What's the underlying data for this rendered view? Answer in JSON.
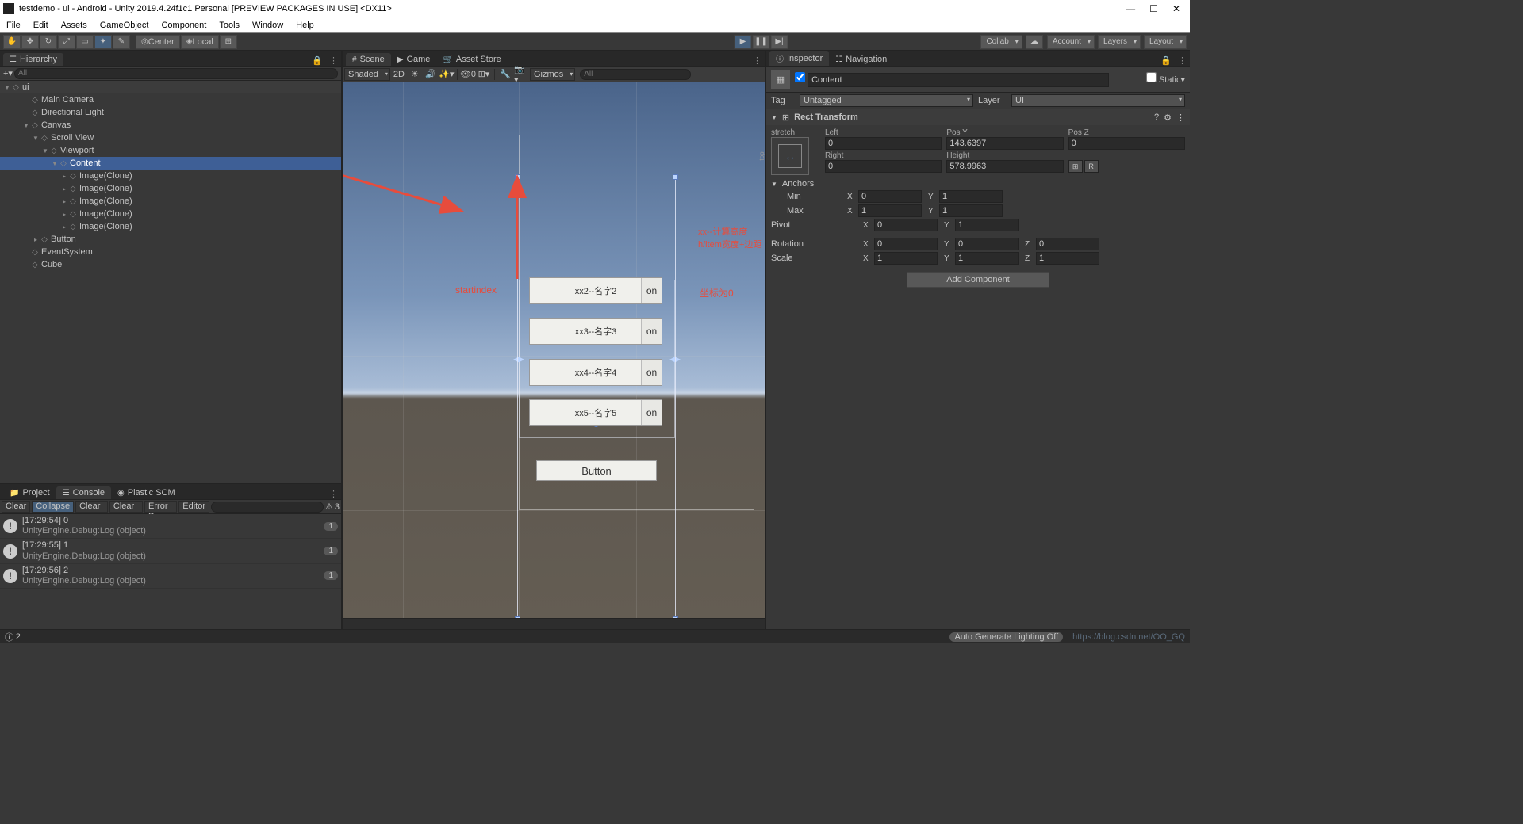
{
  "window": {
    "title": "testdemo - ui - Android - Unity 2019.4.24f1c1 Personal [PREVIEW PACKAGES IN USE] <DX11>"
  },
  "menu": [
    "File",
    "Edit",
    "Assets",
    "GameObject",
    "Component",
    "Tools",
    "Window",
    "Help"
  ],
  "toolbar": {
    "pivot_mode": "Center",
    "handle_mode": "Local",
    "collab": "Collab",
    "account": "Account",
    "layers": "Layers",
    "layout": "Layout"
  },
  "hierarchy": {
    "title": "Hierarchy",
    "search_placeholder": "All",
    "scene": "ui",
    "items": [
      {
        "name": "Main Camera",
        "indent": 2
      },
      {
        "name": "Directional Light",
        "indent": 2
      },
      {
        "name": "Canvas",
        "indent": 2,
        "expanded": true
      },
      {
        "name": "Scroll View",
        "indent": 3,
        "expanded": true
      },
      {
        "name": "Viewport",
        "indent": 4,
        "expanded": true
      },
      {
        "name": "Content",
        "indent": 5,
        "expanded": true,
        "selected": true
      },
      {
        "name": "Image(Clone)",
        "indent": 6,
        "arrow": true
      },
      {
        "name": "Image(Clone)",
        "indent": 6,
        "arrow": true
      },
      {
        "name": "Image(Clone)",
        "indent": 6,
        "arrow": true
      },
      {
        "name": "Image(Clone)",
        "indent": 6,
        "arrow": true
      },
      {
        "name": "Image(Clone)",
        "indent": 6,
        "arrow": true
      },
      {
        "name": "Button",
        "indent": 3,
        "arrow": true
      },
      {
        "name": "EventSystem",
        "indent": 2
      },
      {
        "name": "Cube",
        "indent": 2
      }
    ]
  },
  "bottom_tabs": {
    "project": "Project",
    "console": "Console",
    "scm": "Plastic SCM"
  },
  "console": {
    "clear": "Clear",
    "collapse": "Collapse",
    "clear_play": "Clear on Play",
    "clear_build": "Clear on Build",
    "error_pause": "Error Pause",
    "editor": "Editor",
    "count": "3",
    "logs": [
      {
        "time": "[17:29:54] 0",
        "detail": "UnityEngine.Debug:Log (object)",
        "badge": "1"
      },
      {
        "time": "[17:29:55] 1",
        "detail": "UnityEngine.Debug:Log (object)",
        "badge": "1"
      },
      {
        "time": "[17:29:56] 2",
        "detail": "UnityEngine.Debug:Log (object)",
        "badge": "1"
      }
    ]
  },
  "scene_tabs": {
    "scene": "Scene",
    "game": "Game",
    "asset_store": "Asset Store"
  },
  "scene_toolbar": {
    "draw_mode": "Shaded",
    "twod": "2D",
    "skybox": "0",
    "gizmos": "Gizmos",
    "search_placeholder": "All"
  },
  "scene_items": {
    "item2": "xx2--名字2",
    "item3": "xx3--名字3",
    "item4": "xx4--名字4",
    "item5": "xx5--名字5",
    "on": "on",
    "button": "Button"
  },
  "annotations": {
    "startindex": "startindex",
    "zero": "坐标为0",
    "formula": "xx--计算高度h/item宽度+边距"
  },
  "inspector": {
    "title": "Inspector",
    "nav": "Navigation",
    "name": "Content",
    "static": "Static",
    "tag_label": "Tag",
    "tag": "Untagged",
    "layer_label": "Layer",
    "layer": "UI",
    "rect_transform": {
      "title": "Rect Transform",
      "anchor_v": "stretch",
      "anchor_h": "top",
      "left_label": "Left",
      "left": "0",
      "posy_label": "Pos Y",
      "posy": "143.6397",
      "posz_label": "Pos Z",
      "posz": "0",
      "right_label": "Right",
      "right": "0",
      "height_label": "Height",
      "height": "578.9963",
      "anchors_label": "Anchors",
      "min_label": "Min",
      "min_x": "0",
      "min_y": "1",
      "max_label": "Max",
      "max_x": "1",
      "max_y": "1",
      "pivot_label": "Pivot",
      "pivot_x": "0",
      "pivot_y": "1",
      "rotation_label": "Rotation",
      "rot_x": "0",
      "rot_y": "0",
      "rot_z": "0",
      "scale_label": "Scale",
      "scale_x": "1",
      "scale_y": "1",
      "scale_z": "1"
    },
    "add_component": "Add Component"
  },
  "status": {
    "count": "2",
    "lighting": "Auto Generate Lighting Off",
    "watermark": "https://blog.csdn.net/OO_GQ"
  }
}
